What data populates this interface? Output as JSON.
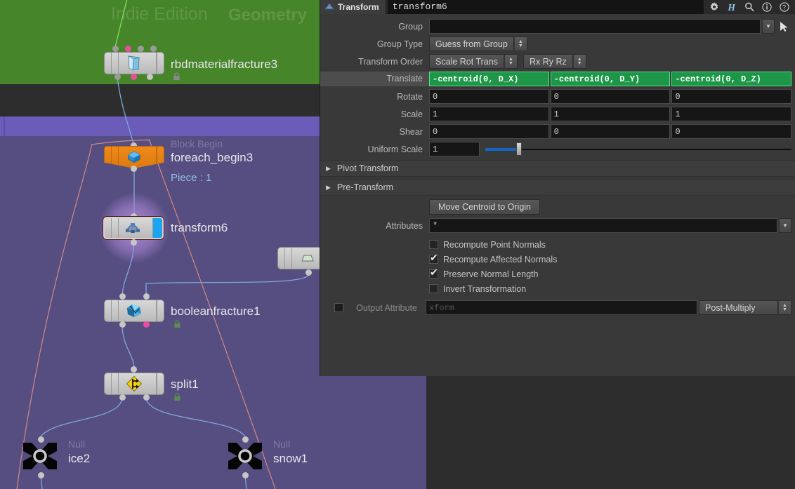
{
  "window": {
    "bg_color": "#2d2d2d"
  },
  "network": {
    "name": "network-editor",
    "background_color": "#564d80",
    "watermarks": [
      {
        "text": "Indie Edition",
        "name": "watermark-indie-edition"
      },
      {
        "text": "Geometry",
        "name": "watermark-geometry"
      }
    ],
    "bands": {
      "geometry_color": "#46852a",
      "dark_color": "#2d2d2d",
      "bright_color": "#6b5cba",
      "base_color": "#564d80"
    },
    "nodes": [
      {
        "name": "rbdmaterialfracture3",
        "type_label": "",
        "sub_label": "",
        "locked": true,
        "selected": false,
        "style": "grey"
      },
      {
        "name": "foreach_begin3",
        "type_label": "Block Begin",
        "sub_label": "Piece : 1",
        "locked": false,
        "selected": false,
        "style": "orange"
      },
      {
        "name": "transform6",
        "type_label": "",
        "sub_label": "",
        "locked": false,
        "selected": true,
        "style": "grey"
      },
      {
        "name": "booleanfracture1",
        "type_label": "",
        "sub_label": "",
        "locked": true,
        "selected": false,
        "style": "grey"
      },
      {
        "name": "split1",
        "type_label": "",
        "sub_label": "",
        "locked": true,
        "selected": false,
        "style": "grey"
      },
      {
        "name": "ice2",
        "type_label": "Null",
        "sub_label": "",
        "locked": false,
        "selected": false,
        "style": "null"
      },
      {
        "name": "snow1",
        "type_label": "Null",
        "sub_label": "",
        "locked": false,
        "selected": false,
        "style": "null"
      }
    ]
  },
  "panel": {
    "tab_label": "Transform",
    "node_path": "transform6",
    "header_icons": [
      "gear-icon",
      "houdini-h-icon",
      "search-icon",
      "info-icon",
      "help-icon"
    ],
    "group": {
      "label": "Group",
      "value": "",
      "placeholder": ""
    },
    "group_type": {
      "label": "Group Type",
      "value": "Guess from Group"
    },
    "transform_order": {
      "label": "Transform Order",
      "value_srt": "Scale Rot Trans",
      "value_rot": "Rx Ry Rz"
    },
    "vector_rows": [
      {
        "label": "Translate",
        "highlighted": true,
        "expression": true,
        "values": [
          "-centroid(0, D_X)",
          "-centroid(0, D_Y)",
          "-centroid(0, D_Z)"
        ]
      },
      {
        "label": "Rotate",
        "highlighted": false,
        "expression": false,
        "values": [
          "0",
          "0",
          "0"
        ]
      },
      {
        "label": "Scale",
        "highlighted": false,
        "expression": false,
        "values": [
          "1",
          "1",
          "1"
        ]
      },
      {
        "label": "Shear",
        "highlighted": false,
        "expression": false,
        "values": [
          "0",
          "0",
          "0"
        ]
      }
    ],
    "uniform_scale": {
      "label": "Uniform Scale",
      "value": "1",
      "slider_percent": 11
    },
    "collapsers": [
      {
        "label": "Pivot Transform",
        "expanded": false
      },
      {
        "label": "Pre-Transform",
        "expanded": false
      }
    ],
    "move_centroid_button": "Move Centroid to Origin",
    "attributes": {
      "label": "Attributes",
      "value": "*"
    },
    "checkboxes": [
      {
        "label": "Recompute Point Normals",
        "checked": false
      },
      {
        "label": "Recompute Affected Normals",
        "checked": true
      },
      {
        "label": "Preserve Normal Length",
        "checked": true
      },
      {
        "label": "Invert Transformation",
        "checked": false
      }
    ],
    "output_attribute": {
      "label": "Output Attribute",
      "enabled": false,
      "placeholder": "xform",
      "value": "",
      "mode": "Post-Multiply"
    },
    "accent_green": "#1e9648",
    "accent_blue": "#1565c0"
  }
}
